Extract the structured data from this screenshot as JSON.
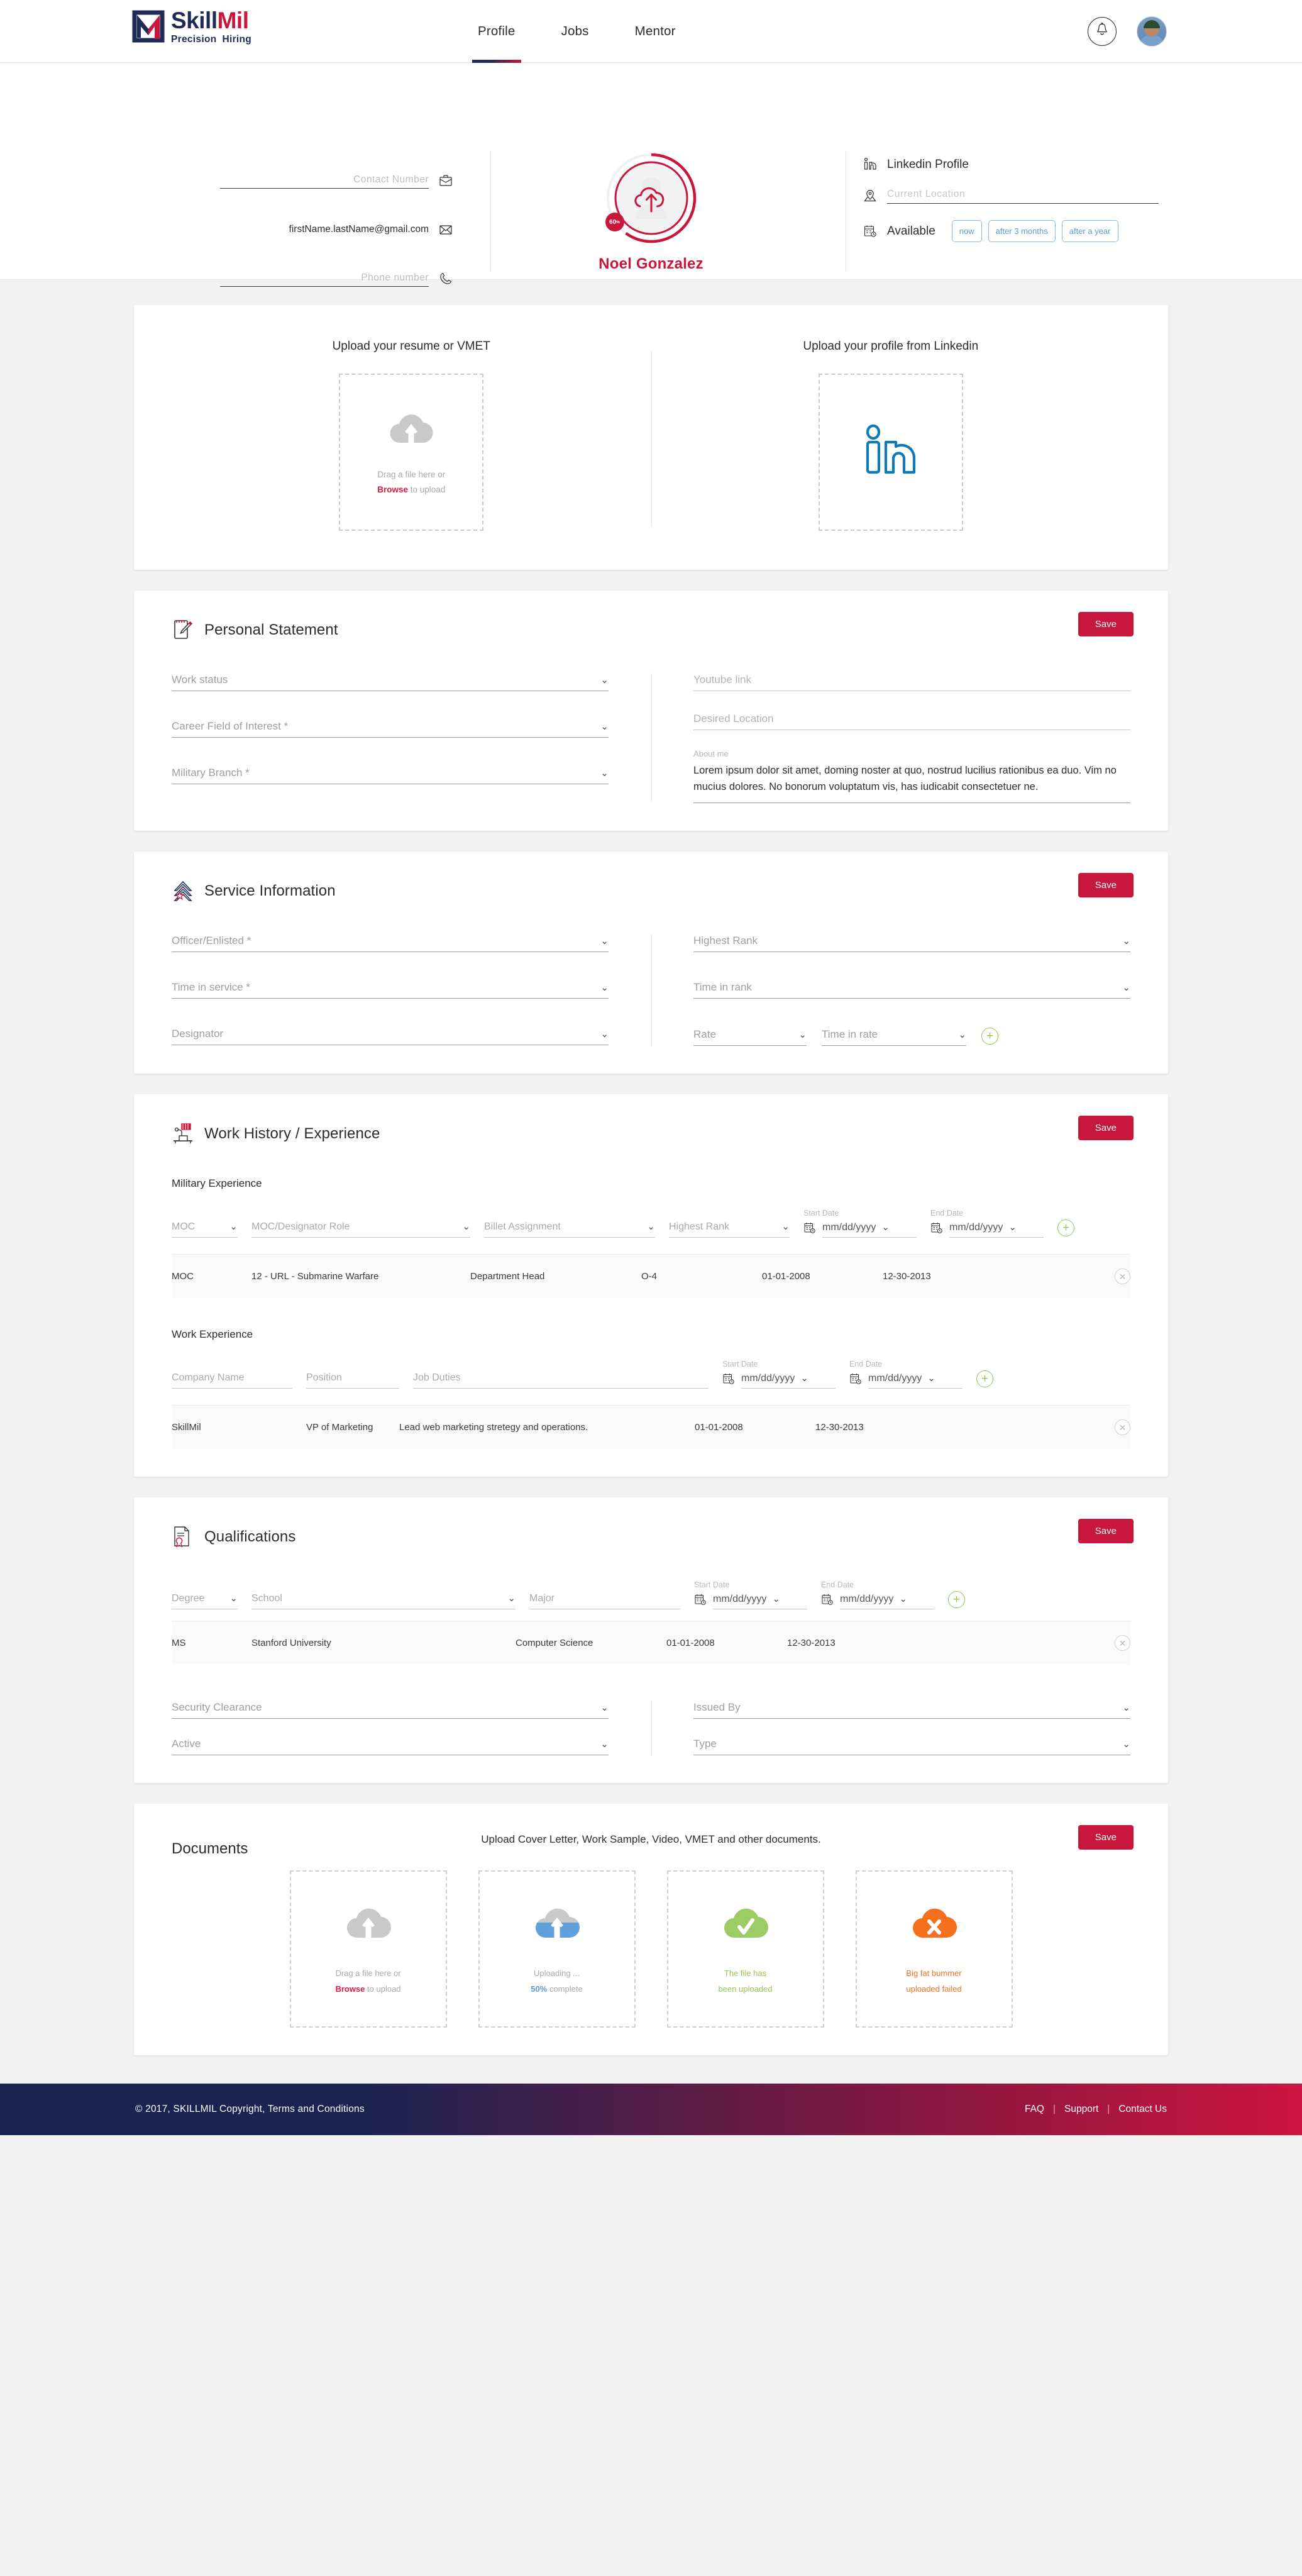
{
  "brand": {
    "name_part1": "Skill",
    "name_part2": "Mil",
    "tagline_1": "Precision",
    "tagline_2": "Hiring",
    "accent_red": "#c8163c",
    "accent_navy": "#1f2a55"
  },
  "nav": {
    "items": [
      {
        "label": "Profile",
        "active": true
      },
      {
        "label": "Jobs",
        "active": false
      },
      {
        "label": "Mentor",
        "active": false
      }
    ]
  },
  "profile_strip": {
    "contact_number_placeholder": "Contact Number",
    "email_value": "firstName.lastName@gmail.com",
    "phone_placeholder": "Phone number",
    "user_name": "Noel Gonzalez",
    "completion_percent": "60",
    "completion_percent_symbol": "%",
    "linkedin_label": "Linkedin Profile",
    "current_location_placeholder": "Current Location",
    "available_label": "Available",
    "availability_options": [
      "now",
      "after 3 months",
      "after a year"
    ]
  },
  "upload": {
    "resume_title": "Upload your resume or VMET",
    "linkedin_title": "Upload your profile from Linkedin",
    "drag_line1": "Drag a file here or",
    "drag_browse": "Browse",
    "drag_line2": " to upload"
  },
  "personal_statement": {
    "title": "Personal Statement",
    "save_label": "Save",
    "work_status_placeholder": "Work status",
    "career_field_placeholder": "Career Field of Interest *",
    "military_branch_placeholder": "Military Branch *",
    "youtube_placeholder": "Youtube link",
    "desired_location_placeholder": "Desired Location",
    "about_me_label": "About me",
    "about_me_text": "Lorem ipsum dolor sit amet, doming noster at quo, nostrud lucilius rationibus ea duo. Vim no mucius dolores. No bonorum voluptatum vis, has iudicabit consectetuer ne."
  },
  "service_information": {
    "title": "Service Information",
    "save_label": "Save",
    "officer_enlisted_placeholder": "Officer/Enlisted *",
    "time_in_service_placeholder": "Time in service *",
    "designator_placeholder": "Designator",
    "highest_rank_placeholder": "Highest Rank",
    "time_in_rank_placeholder": "Time in rank",
    "rate_placeholder": "Rate",
    "time_in_rate_placeholder": "Time in rate"
  },
  "work_history": {
    "title": "Work History / Experience",
    "save_label": "Save",
    "military_label": "Military Experience",
    "military_headers": [
      "MOC",
      "MOC/Designator Role",
      "Billet Assignment",
      "Highest Rank"
    ],
    "start_date_label": "Start Date",
    "end_date_label": "End Date",
    "date_placeholder": "mm/dd/yyyy",
    "military_rows": [
      {
        "moc": "MOC",
        "role": "12 - URL - Submarine Warfare",
        "billet": "Department Head",
        "rank": "O-4",
        "start": "01-01-2008",
        "end": "12-30-2013"
      }
    ],
    "work_label": "Work Experience",
    "work_headers": [
      "Company Name",
      "Position",
      "Job Duties"
    ],
    "work_rows": [
      {
        "company": "SkillMil",
        "position": "VP of Marketing",
        "duties": "Lead web marketing stretegy and operations.",
        "start": "01-01-2008",
        "end": "12-30-2013"
      }
    ]
  },
  "qualifications": {
    "title": "Qualifications",
    "save_label": "Save",
    "headers": [
      "Degree",
      "School",
      "Major"
    ],
    "start_date_label": "Start Date",
    "end_date_label": "End Date",
    "date_placeholder": "mm/dd/yyyy",
    "rows": [
      {
        "degree": "MS",
        "school": "Stanford University",
        "major": "Computer Science",
        "start": "01-01-2008",
        "end": "12-30-2013"
      }
    ],
    "security_clearance_placeholder": "Security Clearance",
    "active_placeholder": "Active",
    "issued_by_placeholder": "Issued By",
    "type_placeholder": "Type"
  },
  "documents": {
    "title": "Documents",
    "save_label": "Save",
    "subtitle": "Upload Cover Letter, Work Sample, Video, VMET and other documents.",
    "zones": [
      {
        "state": "idle",
        "line1": "Drag a file here or",
        "line2_strong": "Browse",
        "line2_rest": " to upload"
      },
      {
        "state": "uploading",
        "line1": "Uploading ...",
        "line2_strong": "50%",
        "line2_rest": " complete"
      },
      {
        "state": "success",
        "line1": "The file has",
        "line2_strong": "been uploaded",
        "line2_rest": ""
      },
      {
        "state": "error",
        "line1": "Big fat bummer",
        "line2_strong": "uploaded failed",
        "line2_rest": ""
      }
    ]
  },
  "footer": {
    "copyright": "© 2017, SKILLMIL   Copyright, Terms and Conditions",
    "links": [
      "FAQ",
      "Support",
      "Contact Us"
    ],
    "separator": "|"
  }
}
